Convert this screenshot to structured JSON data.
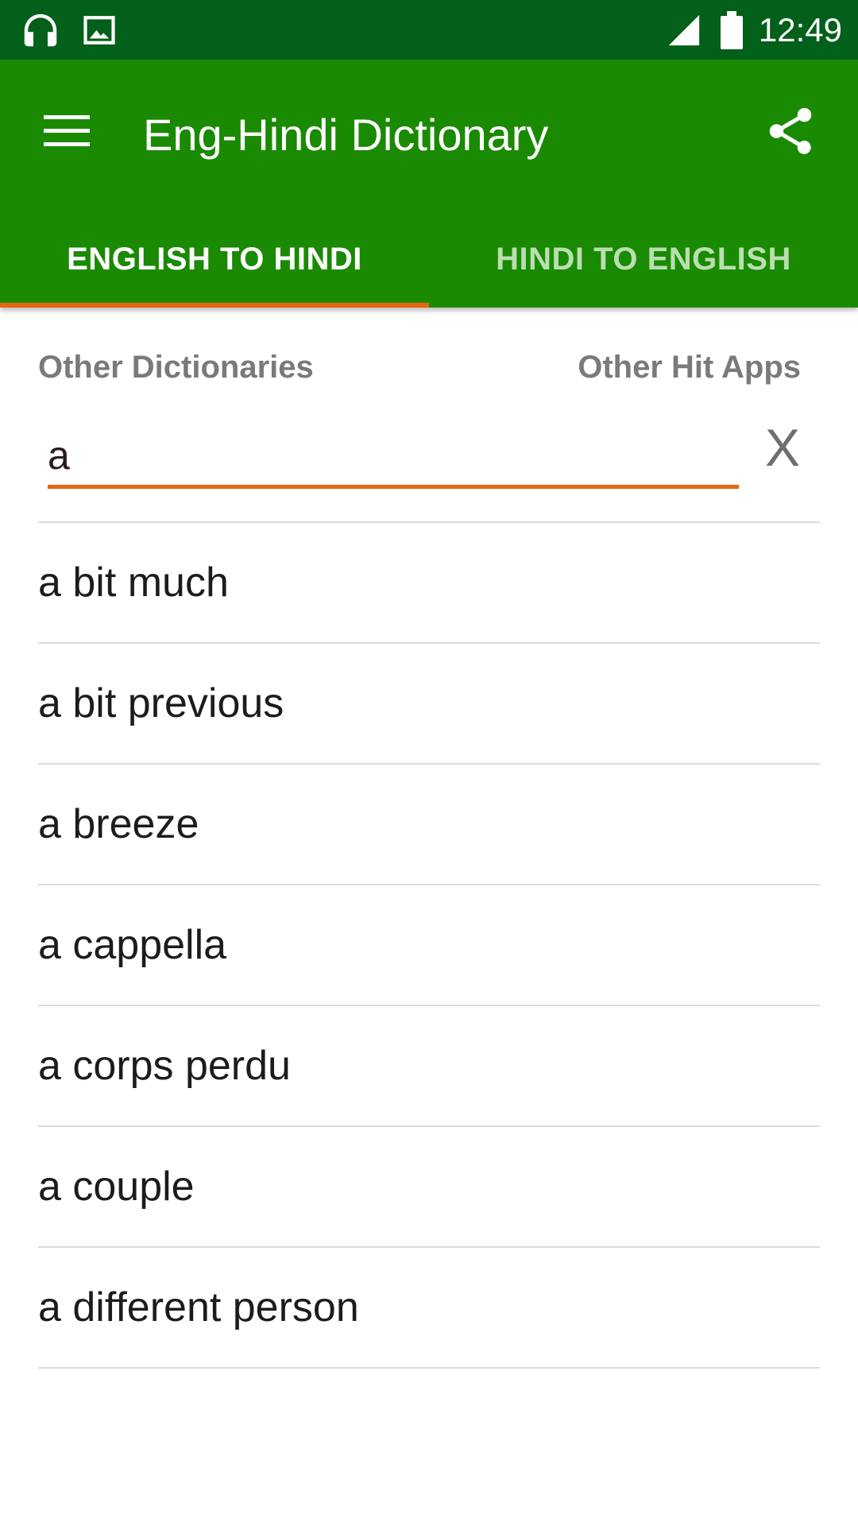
{
  "status_bar": {
    "time": "12:49",
    "icons": [
      "headphones-icon",
      "image-icon",
      "signal-icon",
      "battery-icon"
    ]
  },
  "app_bar": {
    "title": "Eng-Hindi Dictionary",
    "menu_icon": "hamburger-menu-icon",
    "share_icon": "share-icon"
  },
  "tabs": [
    {
      "label": "ENGLISH TO HINDI",
      "active": true
    },
    {
      "label": "HINDI TO ENGLISH",
      "active": false
    }
  ],
  "links": {
    "other_dictionaries": "Other Dictionaries",
    "other_hit_apps": "Other Hit Apps"
  },
  "search": {
    "value": "a",
    "clear_label": "X"
  },
  "results": [
    "a bit much",
    "a bit previous",
    "a breeze",
    "a cappella",
    "a corps perdu",
    "a couple",
    "a different person"
  ],
  "colors": {
    "status_bar": "#02601b",
    "app_bar": "#1a8a03",
    "accent": "#e8660e",
    "inactive_tab": "#b9dfb0"
  }
}
